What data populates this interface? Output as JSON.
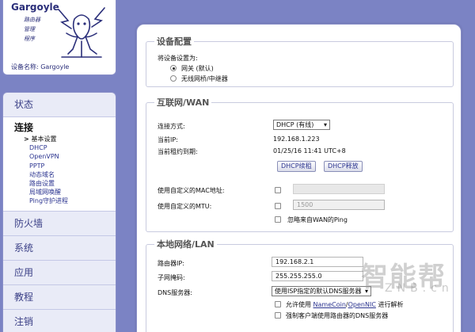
{
  "logo": {
    "title": "Gargoyle",
    "lines": [
      "路由器",
      "管理",
      "程序"
    ],
    "device_name": "设备名称: Gargoyle"
  },
  "nav": {
    "status": "状态",
    "connection": "连接",
    "sub_items": [
      "基本设置",
      "DHCP",
      "OpenVPN",
      "PPTP",
      "动态域名",
      "路由设置",
      "局域网唤醒",
      "Ping守护进程"
    ],
    "firewall": "防火墙",
    "system": "系统",
    "apps": "应用",
    "tutorial": "教程",
    "logout": "注销"
  },
  "device_config": {
    "legend": "设备配置",
    "mode_label": "将设备设置为:",
    "option_gateway": "网关 (默认)",
    "option_wireless": "无线网桥/中继器"
  },
  "wan": {
    "legend": "互联网/WAN",
    "connection_type_label": "连接方式:",
    "connection_type_value": "DHCP (有线)",
    "current_ip_label": "当前IP:",
    "current_ip_value": "192.168.1.223",
    "lease_label": "当前租约到期:",
    "lease_value": "01/25/16 11:41 UTC+8",
    "renew_button": "DHCP续租",
    "release_button": "DHCP释放",
    "mac_label": "使用自定义的MAC地址:",
    "mtu_label": "使用自定义的MTU:",
    "mtu_placeholder": "1500",
    "ignore_ping_label": "忽略来自WAN的Ping"
  },
  "lan": {
    "legend": "本地网络/LAN",
    "router_ip_label": "路由器IP:",
    "router_ip_value": "192.168.2.1",
    "subnet_label": "子网掩码:",
    "subnet_value": "255.255.255.0",
    "dns_label": "DNS服务器:",
    "dns_value": "使用ISP指定的默认DNS服务器",
    "allow_resolve_prefix": "允许使用",
    "namecoin_link": "NameCoin",
    "separator": "/",
    "opennic_link": "OpenNIC",
    "allow_resolve_suffix": "进行解析",
    "force_dns_label": "强制客户端使用路由器的DNS服务器"
  },
  "watermark": {
    "main": "智能帮",
    "sub": "ZNB.cn"
  }
}
